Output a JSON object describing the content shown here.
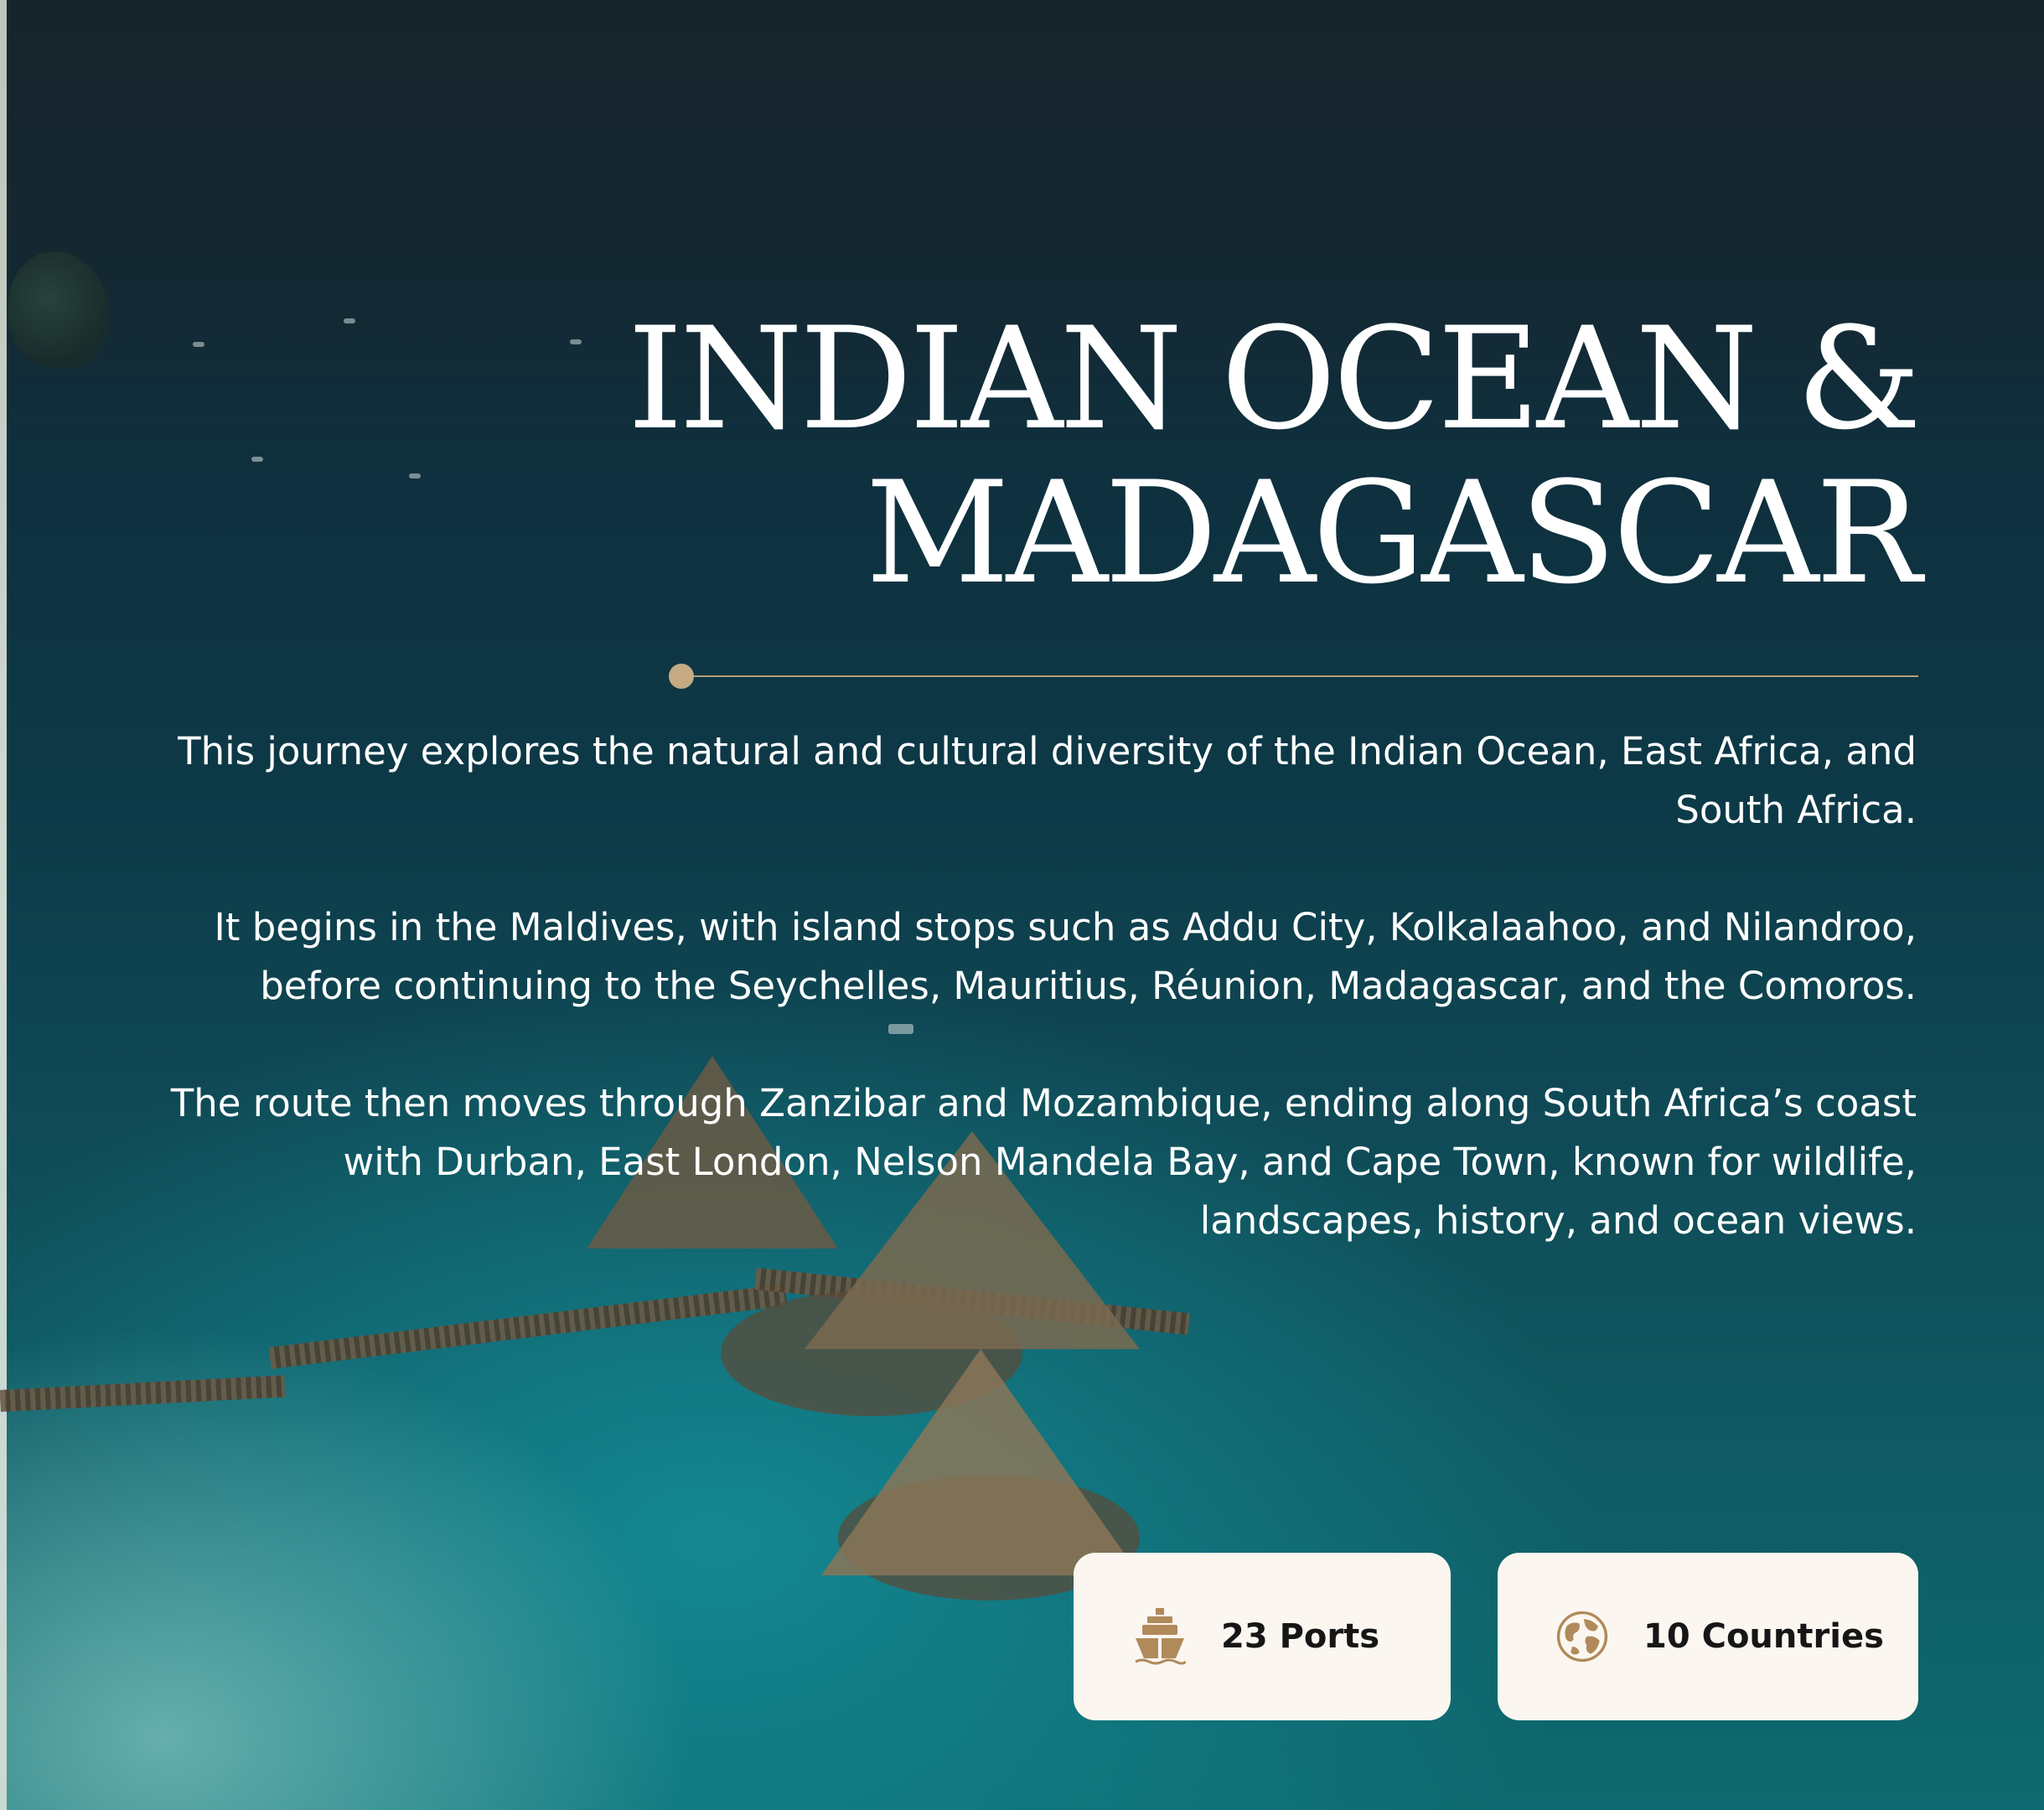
{
  "hero": {
    "title_line1": "INDIAN OCEAN &",
    "title_line2": "MADAGASCAR",
    "paragraphs": [
      "This journey explores the natural and cultural diversity of the Indian Ocean, East Africa, and South Africa.",
      "It begins in the Maldives, with island stops such as Addu City, Kolkalaahoo, and Nilandroo, before continuing to the Seychelles, Mauritius, Réunion, Madagascar, and the Comoros.",
      "The route then moves through Zanzibar and Mozambique, ending along South Africa’s coast with Durban, East London, Nelson Mandela Bay, and Cape Town, known for wildlife, landscapes, history, and ocean views."
    ]
  },
  "stats": {
    "ports": {
      "label": "23 Ports",
      "icon": "ship-icon"
    },
    "countries": {
      "label": "10 Countries",
      "icon": "globe-icon"
    }
  },
  "colors": {
    "accent": "#b99d78",
    "card_bg": "#fbf7f0",
    "text_light": "#ffffff",
    "text_dark": "#161616"
  }
}
